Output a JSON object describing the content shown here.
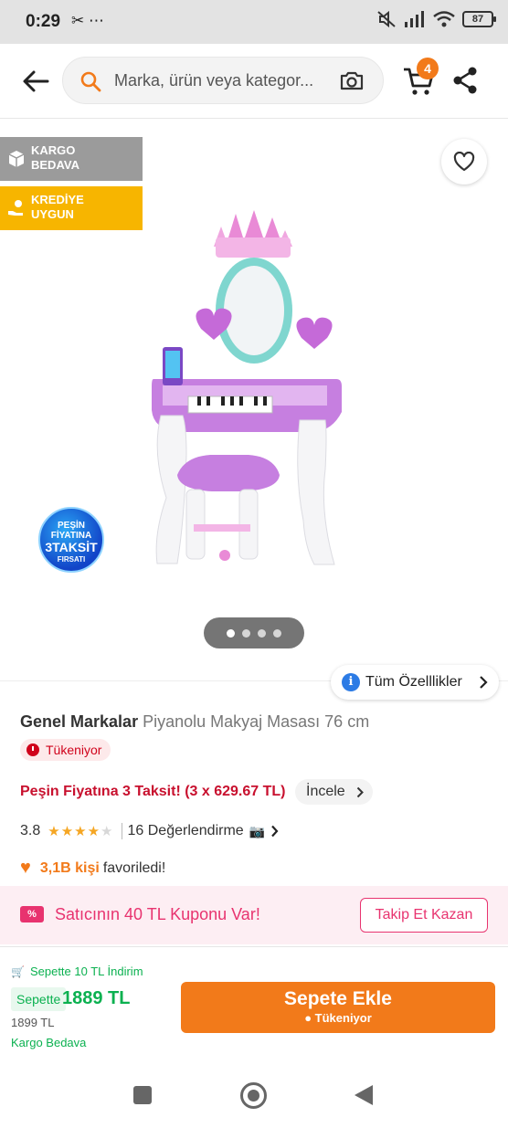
{
  "status_bar": {
    "time": "0:29",
    "left_icons": "✂ ⋯",
    "battery": "87"
  },
  "header": {
    "search_placeholder": "Marka, ürün veya kategor...",
    "cart_count": "4"
  },
  "gallery": {
    "tags": [
      "KARGO BEDAVA",
      "KREDİYE UYGUN"
    ],
    "promo_badge": {
      "line1": "PEŞİN",
      "line2": "FİYATINA",
      "line3": "3TAKSİT",
      "line4": "FIRSATI"
    },
    "page_count": 4,
    "active_page": 1
  },
  "specs": {
    "label": "Tüm Özelllikler"
  },
  "product": {
    "brand": "Genel Markalar",
    "name": "Piyanolu Makyaj Masası 76 cm",
    "stock_badge": "Tükeniyor",
    "installment_text": "Peşin Fiyatına 3 Taksit! (3 x 629.67 TL)",
    "incele_label": "İncele",
    "rating": "3.8",
    "rating_stars": 4,
    "reviews": "16 Değerlendirme",
    "camera_glyph": "📷",
    "fav_count": "3,1B kişi",
    "fav_text": "favoriledi!"
  },
  "coupon": {
    "icon_text": "%",
    "text": "Satıcının 40 TL Kuponu Var!",
    "button": "Takip Et Kazan"
  },
  "bottom_bar": {
    "cart_discount": "Sepette 10 TL İndirim",
    "price_label": "Sepette",
    "price_new": "1889 TL",
    "price_old": "1899 TL",
    "shipping": "Kargo Bedava",
    "add_button": "Sepete Ekle",
    "add_button_sub": "● Tükeniyor"
  },
  "colors": {
    "brand_orange": "#f27a1a",
    "discount_green": "#0bb150",
    "coupon_pink": "#e8336f",
    "stock_red": "#d0021b"
  }
}
